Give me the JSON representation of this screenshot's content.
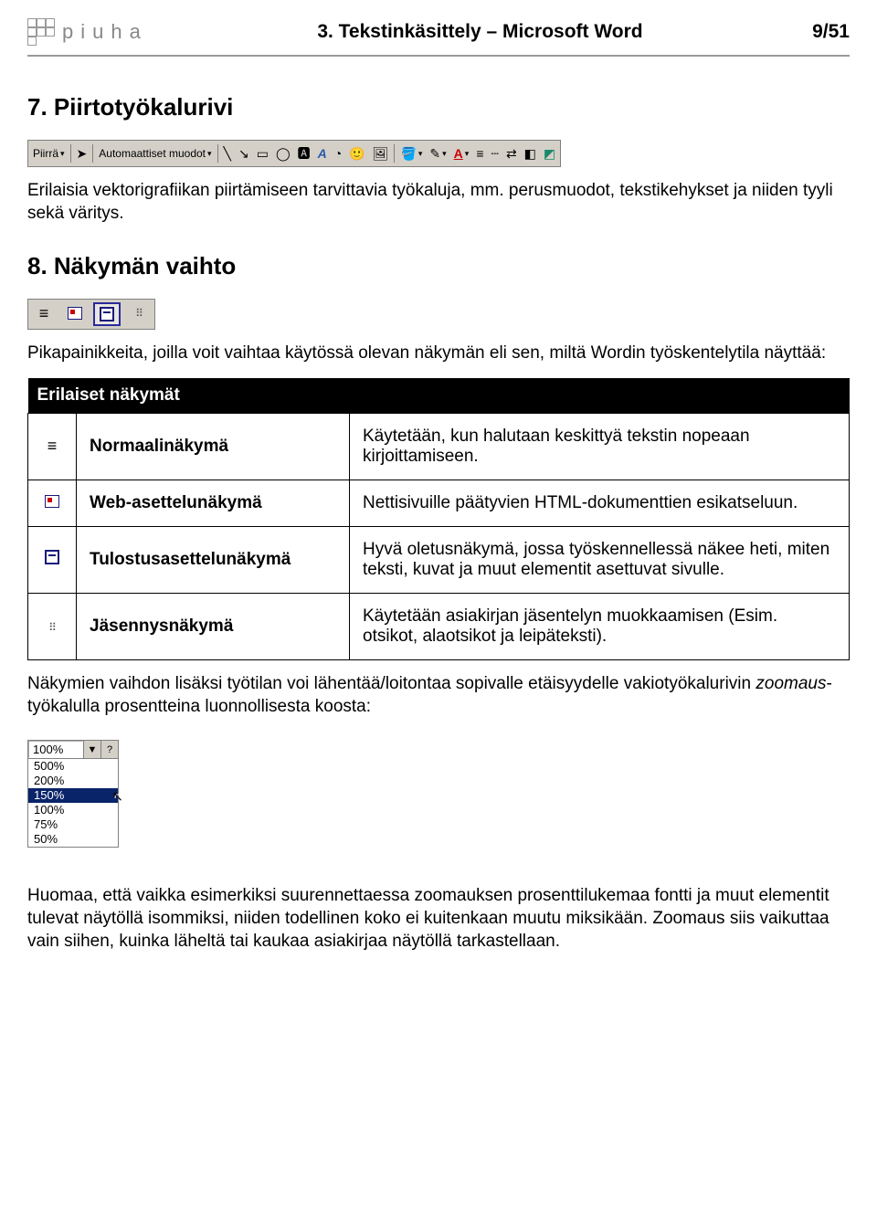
{
  "header": {
    "logo_text": "piuha",
    "title": "3. Tekstinkäsittely – Microsoft Word",
    "page": "9/51"
  },
  "section7": {
    "heading": "7. Piirtotyökalurivi",
    "toolbar": {
      "draw_label": "Piirrä",
      "autoshapes_label": "Automaattiset muodot"
    },
    "para": "Erilaisia vektorigrafiikan piirtämiseen tarvittavia työkaluja, mm. perusmuodot, tekstikehykset ja niiden tyyli sekä väritys."
  },
  "section8": {
    "heading": "8. Näkymän vaihto",
    "para": "Pikapainikkeita, joilla voit vaihtaa käytössä olevan näkymän eli sen, miltä Wordin työskentelytila näyttää:",
    "table_header": "Erilaiset näkymät",
    "rows": [
      {
        "name": "Normaalinäkymä",
        "desc": "Käytetään, kun halutaan keskittyä tekstin nopeaan kirjoittamiseen."
      },
      {
        "name": "Web-asettelunäkymä",
        "desc": "Nettisivuille päätyvien HTML-dokumenttien esikatseluun."
      },
      {
        "name": "Tulostusasettelunäkymä",
        "desc": "Hyvä oletusnäkymä, jossa työskennellessä näkee heti, miten teksti, kuvat ja muut elementit asettuvat sivulle."
      },
      {
        "name": "Jäsennysnäkymä",
        "desc": "Käytetään asiakirjan jäsentelyn muokkaamisen (Esim. otsikot, alaotsikot ja leipäteksti)."
      }
    ],
    "after_table_pre": "Näkymien vaihdon lisäksi työtilan voi lähentää/loitontaa sopivalle etäisyydelle vakiotyökalurivin ",
    "after_table_em": "zoomaus",
    "after_table_post": "-työkalulla prosentteina luonnollisesta koosta:",
    "zoom": {
      "current": "100%",
      "options": [
        "500%",
        "200%",
        "150%",
        "100%",
        "75%",
        "50%"
      ],
      "selected_index": 2
    },
    "final_para": "Huomaa, että vaikka esimerkiksi suurennettaessa zoomauksen prosenttilukemaa fontti ja muut elementit tulevat näytöllä isommiksi, niiden todellinen koko ei kuitenkaan muutu miksikään. Zoomaus siis vaikuttaa vain siihen, kuinka läheltä tai kaukaa asiakirjaa näytöllä tarkastellaan."
  }
}
